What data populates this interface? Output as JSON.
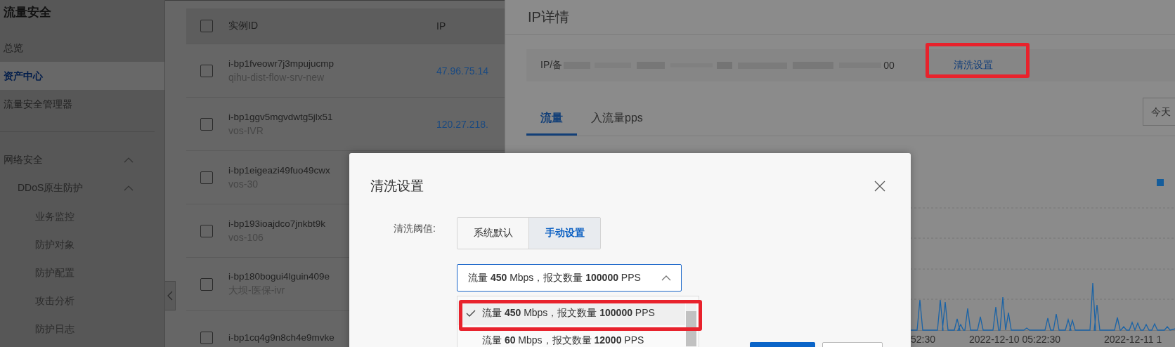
{
  "sidebar": {
    "title": "流量安全",
    "items": [
      {
        "label": "总览",
        "selected": false
      },
      {
        "label": "资产中心",
        "selected": true
      },
      {
        "label": "流量安全管理器",
        "selected": false
      }
    ],
    "groups": [
      {
        "label": "网络安全",
        "expanded": true,
        "children": [
          {
            "label": "DDoS原生防护",
            "expanded": true,
            "children": [
              {
                "label": "业务监控"
              },
              {
                "label": "防护对象"
              },
              {
                "label": "防护配置"
              },
              {
                "label": "攻击分析"
              },
              {
                "label": "防护日志"
              }
            ]
          }
        ]
      }
    ]
  },
  "table": {
    "header_checked": false,
    "columns": [
      "实例ID",
      "IP"
    ],
    "rows": [
      {
        "id": "i-bp1fveowr7j3mpujucmp",
        "name": "qihu-dist-flow-srv-new",
        "ip": "47.96.75.14",
        "checked": false
      },
      {
        "id": "i-bp1ggv5mgvdwtg5jlx51",
        "name": "vos-IVR",
        "ip": "120.27.218.",
        "checked": false
      },
      {
        "id": "i-bp1eigeazi49fuo49cwx",
        "name": "vos-30",
        "checked": false
      },
      {
        "id": "i-bp193ioajdco7jnkbt9k",
        "name": "vos-106",
        "checked": false
      },
      {
        "id": "i-bp180bogui4lguin409e",
        "name": "大坝-医保-ivr",
        "checked": false
      },
      {
        "id": "i-bp1cq4g9n8ch4e9mvke",
        "checked": false
      }
    ]
  },
  "drawer": {
    "title": "IP详情",
    "info": {
      "prefix": "IP/备",
      "suffix": "00",
      "link": "清洗设置"
    },
    "tabs": [
      {
        "label": "流量",
        "selected": true
      },
      {
        "label": "入流量pps",
        "selected": false
      }
    ],
    "date_button": "今天",
    "chart": {
      "x_labels": [
        "52:30",
        "2022-12-10 05:22:30",
        "2022-12-11 1"
      ]
    }
  },
  "dialog": {
    "title": "清洗设置",
    "field_label": "清洗阈值:",
    "modes": [
      {
        "label": "系统默认",
        "selected": false
      },
      {
        "label": "手动设置",
        "selected": true
      }
    ],
    "select": {
      "value": "流量 **450** Mbps，报文数量 **100000** PPS",
      "expanded": true
    },
    "options": [
      {
        "label": "流量 **450** Mbps，报文数量 **100000** PPS",
        "selected": true
      },
      {
        "label": "流量 **60** Mbps，报文数量 **12000** PPS",
        "selected": false
      }
    ]
  }
}
